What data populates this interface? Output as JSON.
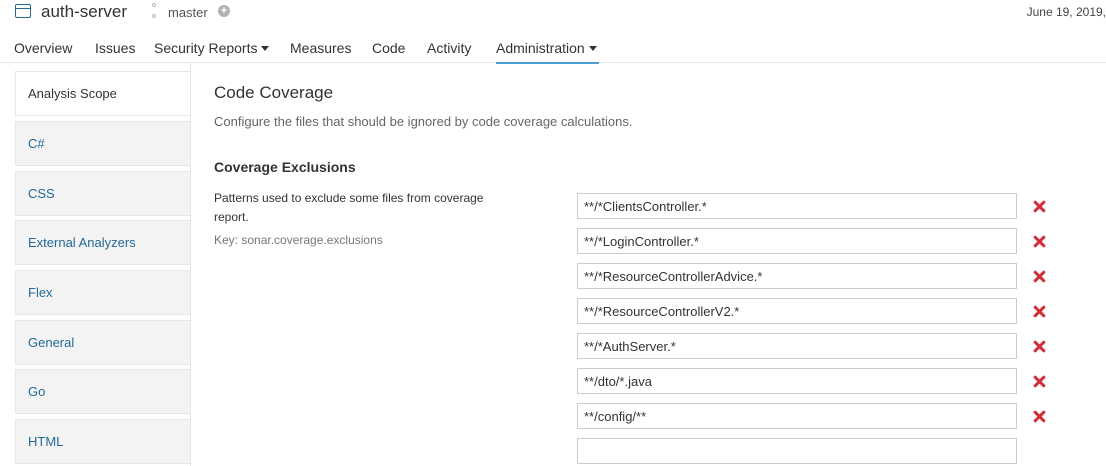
{
  "header": {
    "project_name": "auth-server",
    "branch": "master",
    "branch_add_symbol": "+",
    "date": "June 19, 2019,"
  },
  "nav": [
    {
      "label": "Overview"
    },
    {
      "label": "Issues"
    },
    {
      "label": "Security Reports",
      "has_dropdown": true
    },
    {
      "label": "Measures"
    },
    {
      "label": "Code"
    },
    {
      "label": "Activity"
    },
    {
      "label": "Administration",
      "has_dropdown": true,
      "active": true
    }
  ],
  "sidebar": {
    "items": [
      {
        "label": "Analysis Scope",
        "active": true
      },
      {
        "label": "C#"
      },
      {
        "label": "CSS"
      },
      {
        "label": "External Analyzers"
      },
      {
        "label": "Flex"
      },
      {
        "label": "General"
      },
      {
        "label": "Go"
      },
      {
        "label": "HTML"
      }
    ]
  },
  "main": {
    "title": "Code Coverage",
    "description": "Configure the files that should be ignored by code coverage calculations.",
    "section_title": "Coverage Exclusions",
    "field_description": "Patterns used to exclude some files from coverage report.",
    "field_key": "Key: sonar.coverage.exclusions",
    "patterns": [
      "**/*ClientsController.*",
      "**/*LoginController.*",
      "**/*ResourceControllerAdvice.*",
      "**/*ResourceControllerV2.*",
      "**/*AuthServer.*",
      "**/dto/*.java",
      "**/config/**",
      ""
    ]
  },
  "colors": {
    "accent": "#4b9fd5",
    "link": "#236a97",
    "remove": "#d02f3a"
  }
}
